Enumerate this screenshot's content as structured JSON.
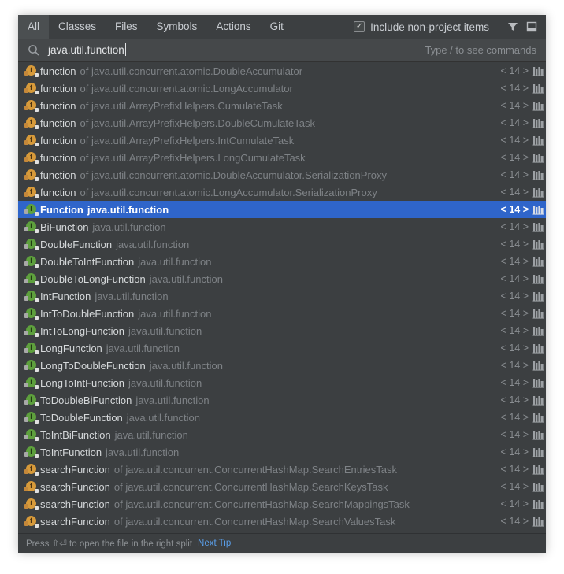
{
  "tabs": [
    {
      "label": "All",
      "active": true
    },
    {
      "label": "Classes"
    },
    {
      "label": "Files"
    },
    {
      "label": "Symbols"
    },
    {
      "label": "Actions"
    },
    {
      "label": "Git"
    }
  ],
  "include_non_project": {
    "label": "Include non-project items",
    "checked": true
  },
  "toolbar_icons": [
    "filter-icon",
    "preview-panel-icon"
  ],
  "search": {
    "value": "java.util.function",
    "hint": "Type / to see commands"
  },
  "results": [
    {
      "kind": "method",
      "name": "function",
      "context": "of java.util.concurrent.atomic.DoubleAccumulator",
      "sdk": "< 14 >"
    },
    {
      "kind": "method",
      "name": "function",
      "context": "of java.util.concurrent.atomic.LongAccumulator",
      "sdk": "< 14 >"
    },
    {
      "kind": "method",
      "name": "function",
      "context": "of java.util.ArrayPrefixHelpers.CumulateTask",
      "sdk": "< 14 >"
    },
    {
      "kind": "method",
      "name": "function",
      "context": "of java.util.ArrayPrefixHelpers.DoubleCumulateTask",
      "sdk": "< 14 >"
    },
    {
      "kind": "method",
      "name": "function",
      "context": "of java.util.ArrayPrefixHelpers.IntCumulateTask",
      "sdk": "< 14 >"
    },
    {
      "kind": "method",
      "name": "function",
      "context": "of java.util.ArrayPrefixHelpers.LongCumulateTask",
      "sdk": "< 14 >"
    },
    {
      "kind": "method",
      "name": "function",
      "context": "of java.util.concurrent.atomic.DoubleAccumulator.SerializationProxy",
      "sdk": "< 14 >"
    },
    {
      "kind": "method",
      "name": "function",
      "context": "of java.util.concurrent.atomic.LongAccumulator.SerializationProxy",
      "sdk": "< 14 >"
    },
    {
      "kind": "interface",
      "name": "Function",
      "context": "java.util.function",
      "sdk": "< 14 >",
      "selected": true
    },
    {
      "kind": "interface",
      "name": "BiFunction",
      "context": "java.util.function",
      "sdk": "< 14 >"
    },
    {
      "kind": "interface",
      "name": "DoubleFunction",
      "context": "java.util.function",
      "sdk": "< 14 >"
    },
    {
      "kind": "interface",
      "name": "DoubleToIntFunction",
      "context": "java.util.function",
      "sdk": "< 14 >"
    },
    {
      "kind": "interface",
      "name": "DoubleToLongFunction",
      "context": "java.util.function",
      "sdk": "< 14 >"
    },
    {
      "kind": "interface",
      "name": "IntFunction",
      "context": "java.util.function",
      "sdk": "< 14 >"
    },
    {
      "kind": "interface",
      "name": "IntToDoubleFunction",
      "context": "java.util.function",
      "sdk": "< 14 >"
    },
    {
      "kind": "interface",
      "name": "IntToLongFunction",
      "context": "java.util.function",
      "sdk": "< 14 >"
    },
    {
      "kind": "interface",
      "name": "LongFunction",
      "context": "java.util.function",
      "sdk": "< 14 >"
    },
    {
      "kind": "interface",
      "name": "LongToDoubleFunction",
      "context": "java.util.function",
      "sdk": "< 14 >"
    },
    {
      "kind": "interface",
      "name": "LongToIntFunction",
      "context": "java.util.function",
      "sdk": "< 14 >"
    },
    {
      "kind": "interface",
      "name": "ToDoubleBiFunction",
      "context": "java.util.function",
      "sdk": "< 14 >"
    },
    {
      "kind": "interface",
      "name": "ToDoubleFunction",
      "context": "java.util.function",
      "sdk": "< 14 >"
    },
    {
      "kind": "interface",
      "name": "ToIntBiFunction",
      "context": "java.util.function",
      "sdk": "< 14 >"
    },
    {
      "kind": "interface",
      "name": "ToIntFunction",
      "context": "java.util.function",
      "sdk": "< 14 >"
    },
    {
      "kind": "method",
      "name": "searchFunction",
      "context": "of java.util.concurrent.ConcurrentHashMap.SearchEntriesTask",
      "sdk": "< 14 >"
    },
    {
      "kind": "method",
      "name": "searchFunction",
      "context": "of java.util.concurrent.ConcurrentHashMap.SearchKeysTask",
      "sdk": "< 14 >"
    },
    {
      "kind": "method",
      "name": "searchFunction",
      "context": "of java.util.concurrent.ConcurrentHashMap.SearchMappingsTask",
      "sdk": "< 14 >"
    },
    {
      "kind": "method",
      "name": "searchFunction",
      "context": "of java.util.concurrent.ConcurrentHashMap.SearchValuesTask",
      "sdk": "< 14 >"
    }
  ],
  "footer": {
    "text": "Press ⇧⏎ to open the file in the right split",
    "link": "Next Tip"
  },
  "colors": {
    "selection": "#2f65ca",
    "background": "#3c3f41",
    "link": "#5a9ee8"
  }
}
